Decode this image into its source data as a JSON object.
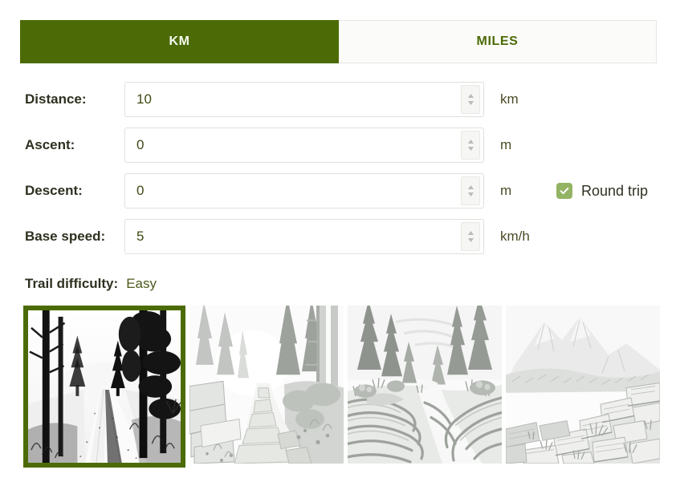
{
  "tabs": [
    {
      "label": "KM",
      "active": true
    },
    {
      "label": "MILES",
      "active": false
    }
  ],
  "form": {
    "distance": {
      "label": "Distance:",
      "value": "10",
      "unit": "km"
    },
    "ascent": {
      "label": "Ascent:",
      "value": "0",
      "unit": "m"
    },
    "descent": {
      "label": "Descent:",
      "value": "0",
      "unit": "m"
    },
    "base_speed": {
      "label": "Base speed:",
      "value": "5",
      "unit": "km/h"
    }
  },
  "round_trip": {
    "label": "Round trip",
    "checked": true
  },
  "difficulty": {
    "label": "Trail difficulty:",
    "value": "Easy"
  },
  "thumbnails": [
    {
      "name": "forest-dirt-path",
      "selected": true
    },
    {
      "name": "stone-paved-forest-path",
      "selected": false
    },
    {
      "name": "rooty-pine-trail",
      "selected": false
    },
    {
      "name": "rocky-mountain-scree",
      "selected": false
    }
  ],
  "colors": {
    "accent_green": "#4c6b07",
    "checkbox_green": "#93b464",
    "field_border": "#dfe0dc",
    "text_dark": "#2f3020",
    "value_green": "#3e4a15"
  }
}
